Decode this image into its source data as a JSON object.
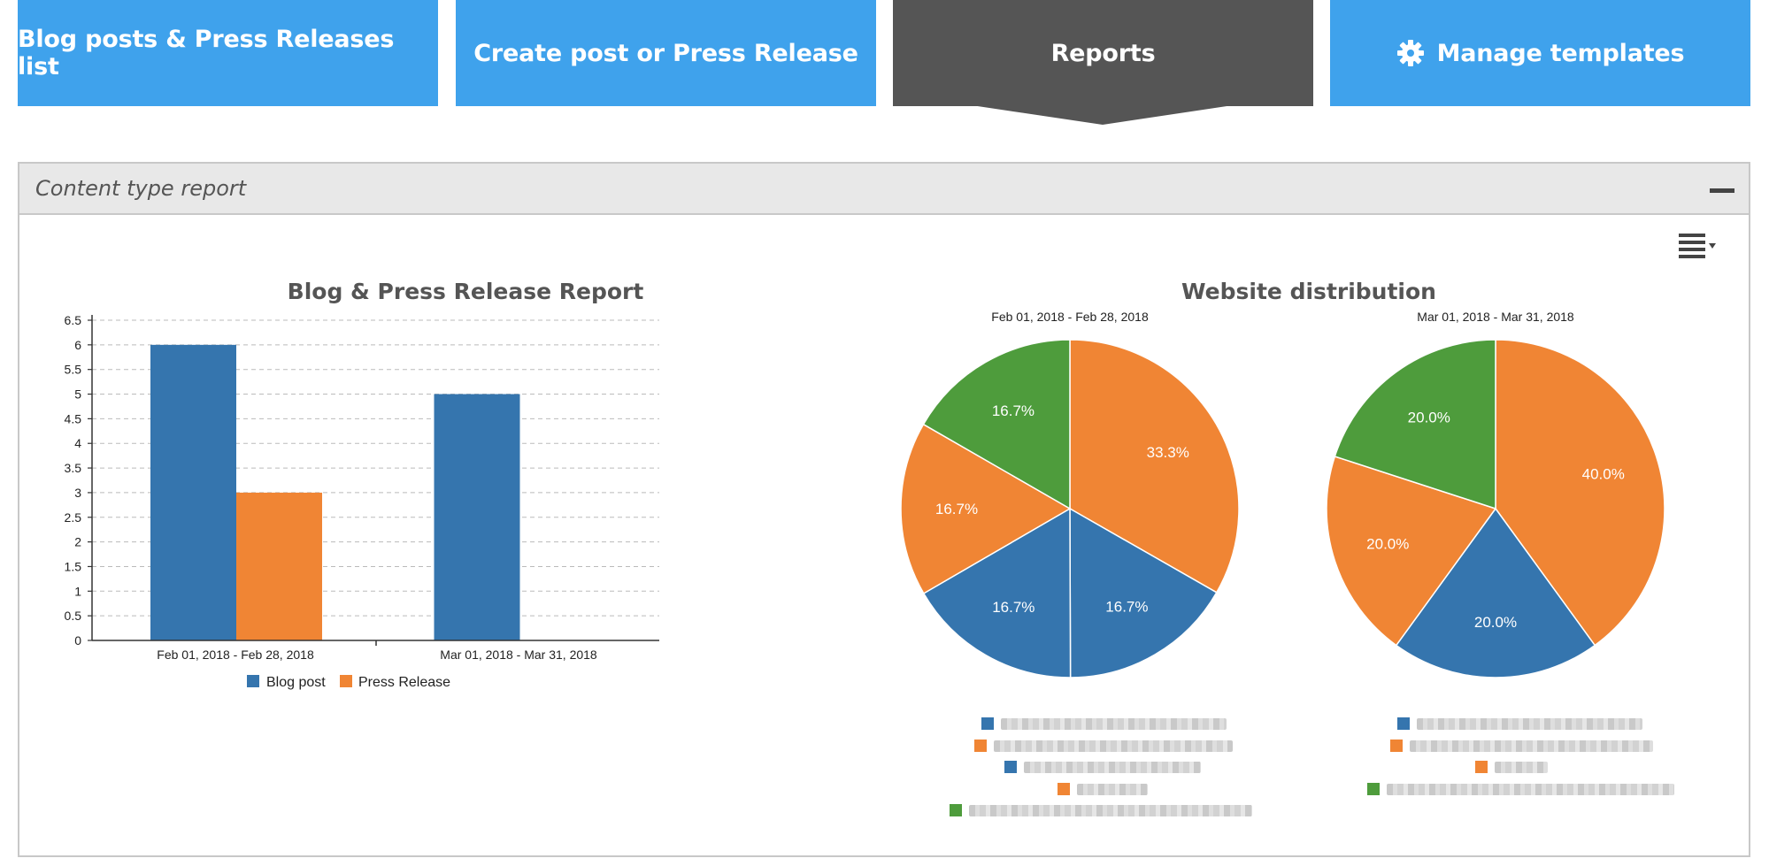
{
  "nav": {
    "items": [
      {
        "label": "Blog posts & Press Releases list",
        "active": false
      },
      {
        "label": "Create post or Press Release",
        "active": false
      },
      {
        "label": "Reports",
        "active": true
      },
      {
        "label": "Manage templates",
        "active": false,
        "icon": "gear-icon"
      }
    ],
    "colors": {
      "default": "#3fa2ec",
      "active": "#555555"
    }
  },
  "panel": {
    "title": "Content type report",
    "collapse_icon": "minus-icon",
    "export_icon": "hamburger-menu-icon"
  },
  "legend_blurred": "Website names in the pie legends are pixelated/unreadable",
  "chart_data": [
    {
      "type": "bar",
      "title": "Blog & Press Release Report",
      "categories": [
        "Feb 01, 2018 - Feb 28, 2018",
        "Mar 01, 2018 - Mar 31, 2018"
      ],
      "series": [
        {
          "name": "Blog post",
          "values": [
            6,
            5
          ],
          "color": "#3575ae"
        },
        {
          "name": "Press Release",
          "values": [
            3,
            0
          ],
          "color": "#f08534"
        }
      ],
      "yticks": [
        "0",
        "0.5",
        "1",
        "1.5",
        "2",
        "2.5",
        "3",
        "3.5",
        "4",
        "4.5",
        "5",
        "5.5",
        "6",
        "6.5"
      ],
      "ylim": [
        0,
        6.5
      ],
      "grid": true,
      "legend": "bottom-center"
    },
    {
      "type": "pie",
      "title": "Website distribution",
      "subtitle": "Feb 01, 2018 - Feb 28, 2018",
      "slices": [
        {
          "value": 33.3,
          "label": "33.3%",
          "color": "#f08534"
        },
        {
          "value": 16.7,
          "label": "16.7%",
          "color": "#3575ae"
        },
        {
          "value": 16.7,
          "label": "16.7%",
          "color": "#3575ae"
        },
        {
          "value": 16.7,
          "label": "16.7%",
          "color": "#f08534"
        },
        {
          "value": 16.7,
          "label": "16.7%",
          "color": "#4e9c3c"
        }
      ],
      "legend_swatches": [
        "#3575ae",
        "#f08534",
        "#3575ae",
        "#f08534",
        "#4e9c3c"
      ]
    },
    {
      "type": "pie",
      "subtitle": "Mar 01, 2018 - Mar 31, 2018",
      "slices": [
        {
          "value": 40.0,
          "label": "40.0%",
          "color": "#f08534"
        },
        {
          "value": 20.0,
          "label": "20.0%",
          "color": "#3575ae"
        },
        {
          "value": 20.0,
          "label": "20.0%",
          "color": "#f08534"
        },
        {
          "value": 20.0,
          "label": "20.0%",
          "color": "#4e9c3c"
        }
      ],
      "legend_swatches": [
        "#3575ae",
        "#f08534",
        "#f08534",
        "#4e9c3c"
      ]
    }
  ]
}
